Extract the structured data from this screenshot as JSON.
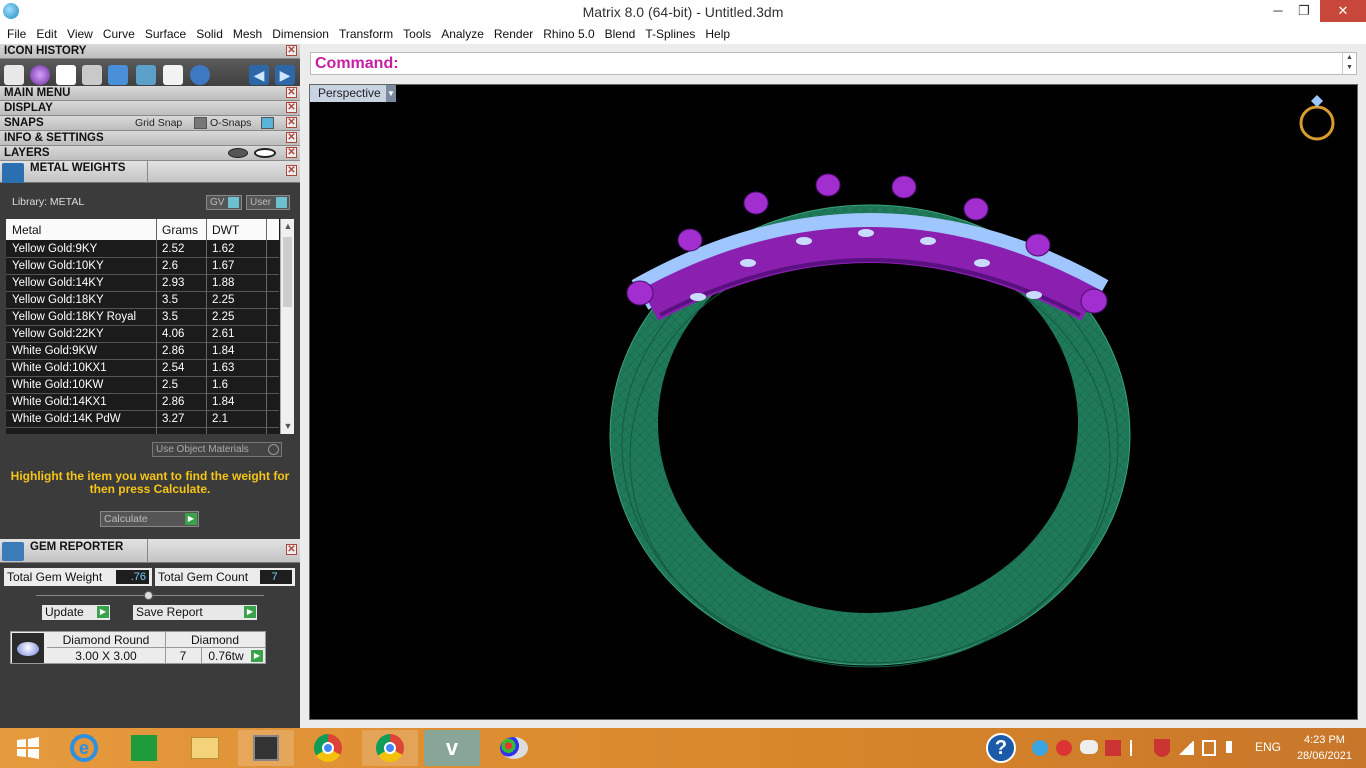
{
  "window": {
    "title": "Matrix 8.0 (64-bit) - Untitled.3dm",
    "minimize": "─",
    "restore": "❐",
    "close": "✕"
  },
  "menu": [
    "File",
    "Edit",
    "View",
    "Curve",
    "Surface",
    "Solid",
    "Mesh",
    "Dimension",
    "Transform",
    "Tools",
    "Analyze",
    "Render",
    "Rhino 5.0",
    "Blend",
    "T-Splines",
    "Help"
  ],
  "panels": {
    "icon_history": "ICON HISTORY",
    "main_menu": "MAIN MENU",
    "display": "DISPLAY",
    "snaps": "SNAPS",
    "grid_snap": "Grid Snap",
    "o_snaps": "O-Snaps",
    "info_settings": "INFO & SETTINGS",
    "layers": "LAYERS",
    "close_glyph": "✕"
  },
  "metal_weights": {
    "title": "METAL WEIGHTS",
    "library": "Library: METAL",
    "gv": "GV",
    "user": "User",
    "columns": [
      "Metal",
      "Grams",
      "DWT"
    ],
    "rows": [
      [
        "Yellow Gold:9KY",
        "2.52",
        "1.62"
      ],
      [
        "Yellow Gold:10KY",
        "2.6",
        "1.67"
      ],
      [
        "Yellow Gold:14KY",
        "2.93",
        "1.88"
      ],
      [
        "Yellow Gold:18KY",
        "3.5",
        "2.25"
      ],
      [
        "Yellow Gold:18KY Royal",
        "3.5",
        "2.25"
      ],
      [
        "Yellow Gold:22KY",
        "4.06",
        "2.61"
      ],
      [
        "White Gold:9KW",
        "2.86",
        "1.84"
      ],
      [
        "White Gold:10KX1",
        "2.54",
        "1.63"
      ],
      [
        "White Gold:10KW",
        "2.5",
        "1.6"
      ],
      [
        "White Gold:14KX1",
        "2.86",
        "1.84"
      ],
      [
        "White Gold:14K PdW",
        "3.27",
        "2.1"
      ]
    ],
    "use_object_materials": "Use Object Materials",
    "hint": "Highlight the item you want to find the weight for then press Calculate.",
    "calculate": "Calculate",
    "scroll_up": "▲",
    "scroll_down": "▼"
  },
  "gem_reporter": {
    "title": "GEM REPORTER",
    "total_weight_label": "Total Gem Weight",
    "total_weight": ".76",
    "total_count_label": "Total Gem Count",
    "total_count": "7",
    "update": "Update",
    "save_report": "Save Report",
    "gem": {
      "shape": "Diamond Round",
      "material": "Diamond",
      "size": "3.00 X 3.00",
      "count": "7",
      "weight": "0.76tw"
    }
  },
  "command": {
    "label": "Command:"
  },
  "viewport": {
    "name": "Perspective"
  },
  "taskbar": {
    "lang": "ENG",
    "time": "4:23 PM",
    "date": "28/06/2021"
  },
  "colors": {
    "metal_green": "#1f7a5a",
    "prong_purple": "#8a1fb0",
    "gem_blue": "#9fc6ff",
    "command_magenta": "#c71fa2",
    "hint_yellow": "#f5c518"
  }
}
